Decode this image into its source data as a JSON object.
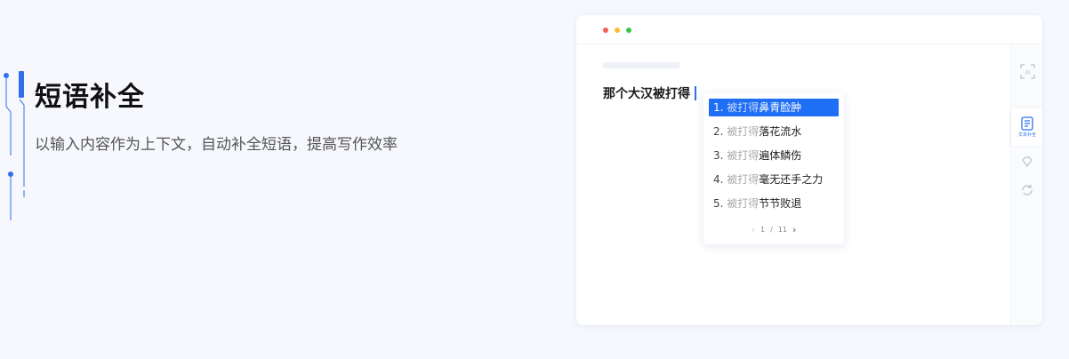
{
  "feature": {
    "title": "短语补全",
    "subtitle": "以输入内容作为上下文，自动补全短语，提高写作效率"
  },
  "editor": {
    "text": "那个大汉被打得"
  },
  "suggestions": [
    {
      "num": "1.",
      "prefix": "被打得",
      "rest": "鼻青脸肿",
      "active": true
    },
    {
      "num": "2.",
      "prefix": "被打得",
      "rest": "落花流水",
      "active": false
    },
    {
      "num": "3.",
      "prefix": "被打得",
      "rest": "遍体鳞伤",
      "active": false
    },
    {
      "num": "4.",
      "prefix": "被打得",
      "rest": "毫无还手之力",
      "active": false
    },
    {
      "num": "5.",
      "prefix": "被打得",
      "rest": "节节败退",
      "active": false
    }
  ],
  "pager": {
    "current": "1",
    "separator": "/",
    "total": "11"
  },
  "rail": [
    {
      "icon": "ai-text-icon",
      "label": ""
    },
    {
      "icon": "document-icon",
      "label": "文本补全",
      "active": true
    },
    {
      "icon": "diamond-icon",
      "label": ""
    },
    {
      "icon": "refresh-icon",
      "label": ""
    }
  ],
  "colors": {
    "accent": "#2f6ff0",
    "active_suggestion": "#1f6ef6",
    "background": "#f6f8fd"
  }
}
